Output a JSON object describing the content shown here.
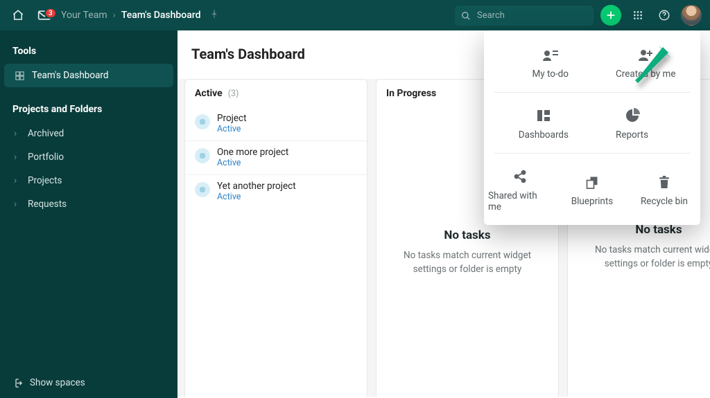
{
  "header": {
    "notification_count": "3",
    "team_label": "Your Team",
    "page_label": "Team's Dashboard",
    "search_placeholder": "Search"
  },
  "sidebar": {
    "section_tools": "Tools",
    "tool_active": "Team's Dashboard",
    "section_projects": "Projects and Folders",
    "items": [
      {
        "label": "Archived"
      },
      {
        "label": "Portfolio"
      },
      {
        "label": "Projects"
      },
      {
        "label": "Requests"
      }
    ],
    "show_spaces": "Show spaces"
  },
  "page": {
    "title": "Team's Dashboard"
  },
  "columns": [
    {
      "title": "Active",
      "count": "(3)",
      "projects": [
        {
          "name": "Project",
          "status": "Active"
        },
        {
          "name": "One more project",
          "status": "Active"
        },
        {
          "name": "Yet another project",
          "status": "Active"
        }
      ]
    },
    {
      "title": "In Progress",
      "empty_title": "No tasks",
      "empty_msg": "No tasks match current widget settings or folder is empty"
    },
    {
      "title": "",
      "empty_title": "No tasks",
      "empty_msg": "No tasks match current widget settings or folder is empty"
    }
  ],
  "apps": {
    "row1": [
      {
        "label": "My to-do"
      },
      {
        "label": "Created by me"
      }
    ],
    "row2": [
      {
        "label": "Dashboards"
      },
      {
        "label": "Reports"
      }
    ],
    "row3": [
      {
        "label": "Shared with me"
      },
      {
        "label": "Blueprints"
      },
      {
        "label": "Recycle bin"
      }
    ]
  }
}
